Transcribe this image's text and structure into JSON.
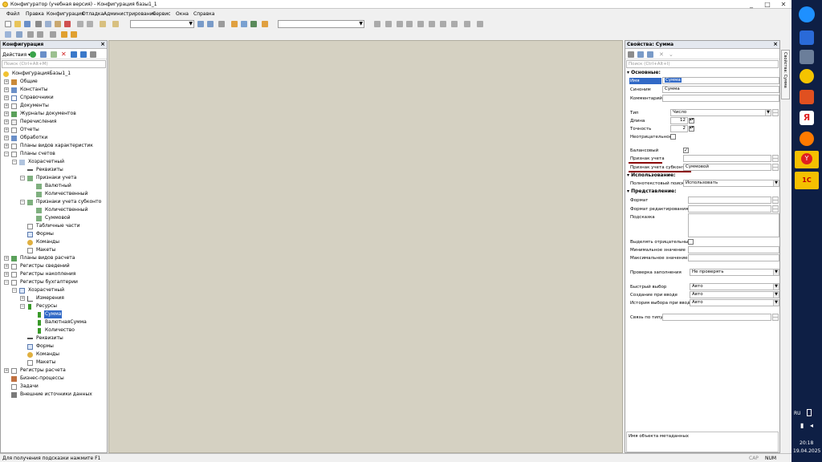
{
  "window": {
    "title": "Конфигуратор (учебная версия) - Конфигурация базы1_1",
    "min": "_",
    "max": "□",
    "close": "✕"
  },
  "menu": [
    "Файл",
    "Правка",
    "Конфигурация",
    "Отладка",
    "Администрирование",
    "Сервис",
    "Окна",
    "Справка"
  ],
  "left_panel": {
    "title": "Конфигурация",
    "actions_label": "Действия",
    "search_placeholder": "Поиск (Ctrl+Alt+M)",
    "tree": [
      "КонфигурацияБазы1_1",
      "Общие",
      "Константы",
      "Справочники",
      "Документы",
      "Журналы документов",
      "Перечисления",
      "Отчеты",
      "Обработки",
      "Планы видов характеристик",
      "Планы счетов",
      "Хозрасчетный",
      "Реквизиты",
      "Признаки учета",
      "Валютный",
      "Количественный",
      "Признаки учета субконто",
      "Количественный",
      "Суммовой",
      "Табличные части",
      "Формы",
      "Команды",
      "Макеты",
      "Планы видов расчета",
      "Регистры сведений",
      "Регистры накопления",
      "Регистры бухгалтерии",
      "Хозрасчетный",
      "Измерения",
      "Ресурсы",
      "Сумма",
      "ВалютнаяСумма",
      "Количество",
      "Реквизиты",
      "Формы",
      "Команды",
      "Макеты",
      "Регистры расчета",
      "Бизнес-процессы",
      "Задачи",
      "Внешние источники данных"
    ]
  },
  "props_panel": {
    "title": "Свойства: Сумма",
    "search_placeholder": "Поиск (Ctrl+Alt+I)",
    "sections": {
      "basic": "Основные:",
      "usage": "Использование:",
      "presentation": "Представление:"
    },
    "labels": {
      "name": "Имя",
      "synonym": "Синоним",
      "comment": "Комментарий",
      "type": "Тип",
      "length": "Длина",
      "precision": "Точность",
      "nonneg": "Неотрицательное",
      "balance": "Балансовый",
      "acct_flag": "Признак учета",
      "subkonto_flag": "Признак учета субконто",
      "fulltext": "Полнотекстовый поиск",
      "format": "Формат",
      "edit_format": "Формат редактирования",
      "tooltip": "Подсказка",
      "mark_neg": "Выделять отрицательные",
      "min_val": "Минимальное значение",
      "max_val": "Максимальное значение",
      "fill_check": "Проверка заполнения",
      "quick_choice": "Быстрый выбор",
      "create_on_input": "Создание при вводе",
      "choice_history": "История выбора при вводе",
      "type_link": "Связь по типу"
    },
    "values": {
      "name": "Сумма",
      "synonym": "Сумма",
      "type": "Число",
      "length": "12",
      "precision": "2",
      "subkonto_flag": "Суммовой",
      "fulltext": "Использовать",
      "fill_check": "Не проверять",
      "quick_choice": "Авто",
      "create_on_input": "Авто",
      "choice_history": "Авто"
    },
    "footer": "Имя объекта метаданных",
    "side_tab": "Свойства: Сумма"
  },
  "status": {
    "hint": "Для получения подсказки нажмите F1",
    "cap": "CAP",
    "num": "NUM"
  },
  "taskbar": {
    "lang": "RU",
    "time": "20:18",
    "date": "19.04.2025",
    "yandex": "Я",
    "onec": "1С"
  }
}
